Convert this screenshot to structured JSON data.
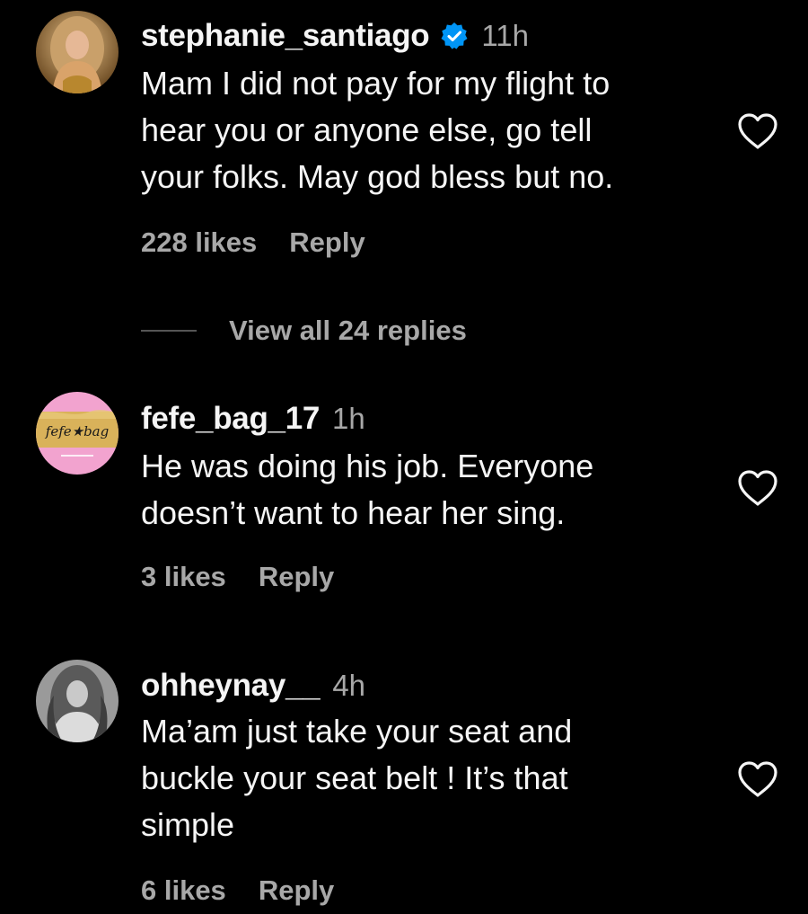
{
  "colors": {
    "background": "#000000",
    "primary_text": "#f5f5f5",
    "secondary_text": "#a8a8a8",
    "verified_badge": "#0095f6",
    "divider": "#555555"
  },
  "comments": [
    {
      "username": "stephanie_santiago",
      "verified": true,
      "time": "11h",
      "text": "Mam I did not pay for my flight to\nhear you or anyone else, go tell\nyour folks. May god bless but no.",
      "likes": "228 likes",
      "reply": "Reply",
      "avatar_icon": "profile-photo",
      "like_icon": "heart-outline-icon"
    },
    {
      "username": "fefe_bag_17",
      "verified": false,
      "time": "1h",
      "text": "He was doing his job. Everyone\ndoesn’t want to hear her sing.",
      "likes": "3 likes",
      "reply": "Reply",
      "avatar_logo_text": "fefe★bag",
      "like_icon": "heart-outline-icon"
    },
    {
      "username": "ohheynay__",
      "verified": false,
      "time": "4h",
      "text": "Ma’am just take your seat and\nbuckle your seat belt ! It’s that\nsimple",
      "likes": "6 likes",
      "reply": "Reply",
      "avatar_icon": "profile-photo",
      "like_icon": "heart-outline-icon"
    }
  ],
  "view_replies": {
    "label": "View all 24 replies"
  }
}
